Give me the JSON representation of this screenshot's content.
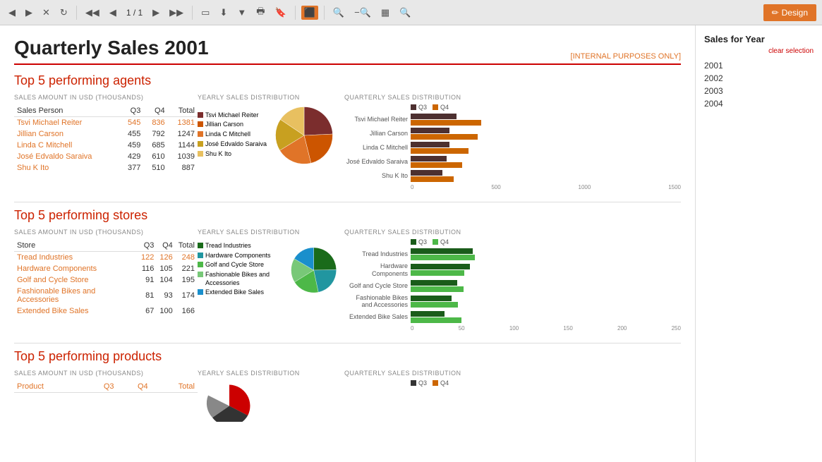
{
  "toolbar": {
    "back_label": "◀",
    "forward_label": "▶",
    "close_label": "✕",
    "refresh_label": "↺",
    "rewind_label": "◀◀",
    "prev_label": "◀",
    "page_current": "1",
    "page_total": "1",
    "next_label": "▶",
    "ffwd_label": "▶▶",
    "page_view_label": "⊞",
    "download_label": "⬇",
    "print_label": "🖨",
    "bookmark_label": "🔖",
    "filter_label": "⧩",
    "zoom_in_label": "🔍+",
    "zoom_out_label": "🔍-",
    "gallery_label": "⊟",
    "search_label": "🔍",
    "design_label": "Design"
  },
  "report": {
    "title": "Quarterly Sales 2001",
    "internal_note": "[INTERNAL PURPOSES ONLY]",
    "sections": {
      "agents": {
        "heading": "Top 5 performing agents",
        "table_subtitle": "SALES AMOUNT IN USD (THOUSANDS)",
        "columns": [
          "Sales Person",
          "Q3",
          "Q4",
          "Total"
        ],
        "rows": [
          [
            "Tsvi Michael Reiter",
            "545",
            "836",
            "1381"
          ],
          [
            "Jillian  Carson",
            "455",
            "792",
            "1247"
          ],
          [
            "Linda C Mitchell",
            "459",
            "685",
            "1144"
          ],
          [
            "José Edvaldo Saraiva",
            "429",
            "610",
            "1039"
          ],
          [
            "Shu K Ito",
            "377",
            "510",
            "887"
          ]
        ],
        "yearly_label": "YEARLY SALES DISTRIBUTION",
        "quarterly_label": "QUARTERLY SALES DISTRIBUTION",
        "pie": {
          "segments": [
            {
              "label": "Tsvi Michael Reiter",
              "color": "#7b2d2d",
              "value": 1381,
              "startAngle": 0
            },
            {
              "label": "Jillian  Carson",
              "color": "#cc5500",
              "value": 1247
            },
            {
              "label": "Linda C Mitchell",
              "color": "#e07428",
              "value": 1144
            },
            {
              "label": "José Edvaldo Saraiva",
              "color": "#c8a020",
              "value": 1039
            },
            {
              "label": "Shu K Ito",
              "color": "#e8c060",
              "value": 887
            }
          ]
        },
        "bars": [
          {
            "label": "Tsvi Michael Reiter",
            "q3": 545,
            "q4": 836,
            "max": 1500
          },
          {
            "label": "Jillian  Carson",
            "q3": 455,
            "q4": 792,
            "max": 1500
          },
          {
            "label": "Linda C Mitchell",
            "q3": 459,
            "q4": 685,
            "max": 1500
          },
          {
            "label": "José Edvaldo Saraiva",
            "q3": 429,
            "q4": 610,
            "max": 1500
          },
          {
            "label": "Shu K Ito",
            "q3": 377,
            "q4": 510,
            "max": 1500
          }
        ],
        "bar_axis": [
          "0",
          "500",
          "1000",
          "1500"
        ],
        "colors": {
          "q3": "#4d3030",
          "q4": "#cc6600"
        }
      },
      "stores": {
        "heading": "Top 5 performing stores",
        "table_subtitle": "SALES AMOUNT IN USD (THOUSANDS)",
        "columns": [
          "Store",
          "Q3",
          "Q4",
          "Total"
        ],
        "rows": [
          [
            "Tread Industries",
            "122",
            "126",
            "248"
          ],
          [
            "Hardware Components",
            "116",
            "105",
            "221"
          ],
          [
            "Golf and Cycle Store",
            "91",
            "104",
            "195"
          ],
          [
            "Fashionable Bikes and Accessories",
            "81",
            "93",
            "174"
          ],
          [
            "Extended Bike Sales",
            "67",
            "100",
            "166"
          ]
        ],
        "yearly_label": "YEARLY SALES DISTRIBUTION",
        "quarterly_label": "QUARTERLY SALES DISTRIBUTION",
        "pie": {
          "segments": [
            {
              "label": "Tread Industries",
              "color": "#1a6b1a",
              "value": 248
            },
            {
              "label": "Hardware Components",
              "color": "#2196a0",
              "value": 221
            },
            {
              "label": "Golf and Cycle Store",
              "color": "#4db848",
              "value": 195
            },
            {
              "label": "Fashionable Bikes and Accessories",
              "color": "#78c878",
              "value": 174
            },
            {
              "label": "Extended Bike Sales",
              "color": "#1a8fcc",
              "value": 166
            }
          ]
        },
        "bars": [
          {
            "label": "Tread Industries",
            "q3": 122,
            "q4": 126,
            "max": 250
          },
          {
            "label": "Hardware Components",
            "q3": 116,
            "q4": 105,
            "max": 250
          },
          {
            "label": "Golf and Cycle Store",
            "q3": 91,
            "q4": 104,
            "max": 250
          },
          {
            "label": "Fashionable Bikes and Accessories",
            "q3": 81,
            "q4": 93,
            "max": 250
          },
          {
            "label": "Extended Bike Sales",
            "q3": 67,
            "q4": 100,
            "max": 250
          }
        ],
        "bar_axis": [
          "0",
          "50",
          "100",
          "150",
          "200",
          "250"
        ],
        "colors": {
          "q3": "#1a5c1a",
          "q4": "#4db848"
        }
      },
      "products": {
        "heading": "Top 5 performing products",
        "table_subtitle": "SALES AMOUNT IN USD (THOUSANDS)",
        "columns": [
          "Product",
          "Q3",
          "Q4",
          "Total"
        ],
        "rows": [],
        "yearly_label": "YEARLY SALES DISTRIBUTION",
        "quarterly_label": "QUARTERLY SALES DISTRIBUTION",
        "colors": {
          "q3": "#333",
          "q4": "#cc6600"
        }
      }
    }
  },
  "sidebar": {
    "title": "Sales for Year",
    "clear_label": "clear selection",
    "years": [
      "2001",
      "2002",
      "2003",
      "2004"
    ]
  }
}
